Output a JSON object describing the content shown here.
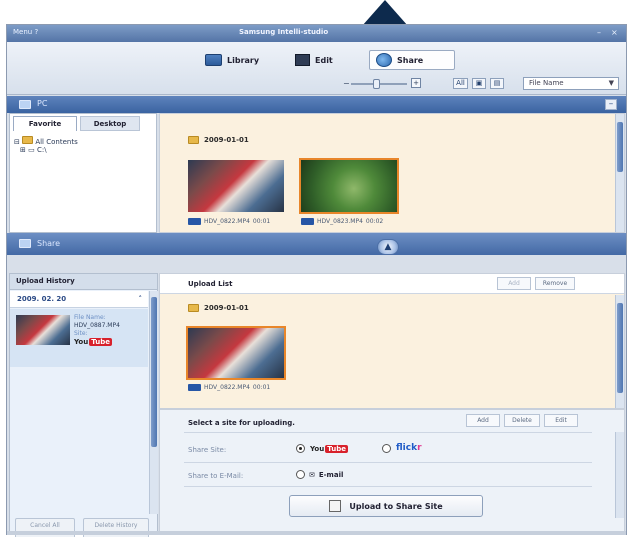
{
  "window": {
    "menu_label": "Menu ?",
    "title": "Samsung Intelli-studio",
    "controls": [
      "–",
      "×"
    ]
  },
  "toolbar": {
    "library_label": "Library",
    "edit_label": "Edit",
    "share_label": "Share",
    "zoom_plus": "+",
    "zoom_minus": "−",
    "view_all": "All",
    "view_photo": "▣",
    "view_video": "▤",
    "sort_value": "File Name",
    "sort_caret": "▼"
  },
  "pc_panel": {
    "title": "PC",
    "collapse": "–",
    "tabs": [
      "Favorite",
      "Desktop"
    ],
    "tree": [
      "All Contents",
      "C:\\"
    ],
    "folder_date": "2009-01-01",
    "items": [
      {
        "caption": "HDV_0822.MP4",
        "duration": "00:01",
        "selected": false
      },
      {
        "caption": "HDV_0823.MP4",
        "duration": "00:02",
        "selected": true
      }
    ],
    "splitter": "▲"
  },
  "share_panel": {
    "title": "Share",
    "history_header": "Upload History",
    "history_date": "2009. 02. 20",
    "history_item": {
      "line1": "File Name:",
      "line2": "HDV_0887.MP4",
      "line3": "Site:",
      "site_you": "You",
      "site_tube": "Tube"
    },
    "history_buttons": [
      "Cancel All",
      "Delete History"
    ],
    "upload_list_title": "Upload List",
    "upload_list_buttons": [
      "Add",
      "Remove"
    ],
    "list_date": "2009-01-01",
    "list_item": {
      "caption": "HDV_0822.MP4",
      "duration": "00:01"
    },
    "select_title": "Select a site for uploading.",
    "site_buttons": [
      "Add",
      "Delete",
      "Edit"
    ],
    "share_site_label": "Share Site:",
    "share_email_label": "Share to E-Mail:",
    "site_youtube_you": "You",
    "site_youtube_tube": "Tube",
    "site_flickr_a": "flick",
    "site_flickr_b": "r",
    "email_option": "E-mail",
    "upload_button": "Upload to Share Site"
  },
  "colors": {
    "accent": "#3a63a1",
    "selection": "#e8862a",
    "youtube_red": "#d8212b",
    "flickr_blue": "#1f5bc7",
    "flickr_pink": "#e0378f"
  }
}
